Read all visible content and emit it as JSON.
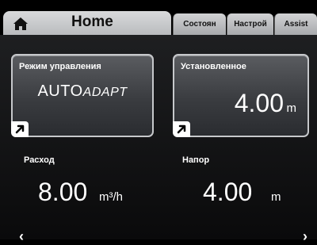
{
  "tabs": {
    "home_label": "Home",
    "items": [
      {
        "label": "Состоян"
      },
      {
        "label": "Настрой"
      },
      {
        "label": "Assist"
      }
    ]
  },
  "cards": {
    "control_mode": {
      "label": "Режим управления",
      "value_main": "AUTO",
      "value_suffix": "ADAPT"
    },
    "setpoint": {
      "label": "Установленное",
      "value": "4.00",
      "unit": "m"
    }
  },
  "metrics": {
    "flow": {
      "label": "Расход",
      "value": "8.00",
      "unit": "m³/h"
    },
    "head": {
      "label": "Напор",
      "value": "4.00",
      "unit": "m"
    }
  },
  "nav": {
    "prev": "‹",
    "next": "›"
  },
  "icons": {
    "home": "home-icon",
    "jump": "jump-arrow-icon"
  },
  "colors": {
    "background": "#000000",
    "tab_active": "#c8c9cb",
    "card_border": "#c6c8cb"
  }
}
